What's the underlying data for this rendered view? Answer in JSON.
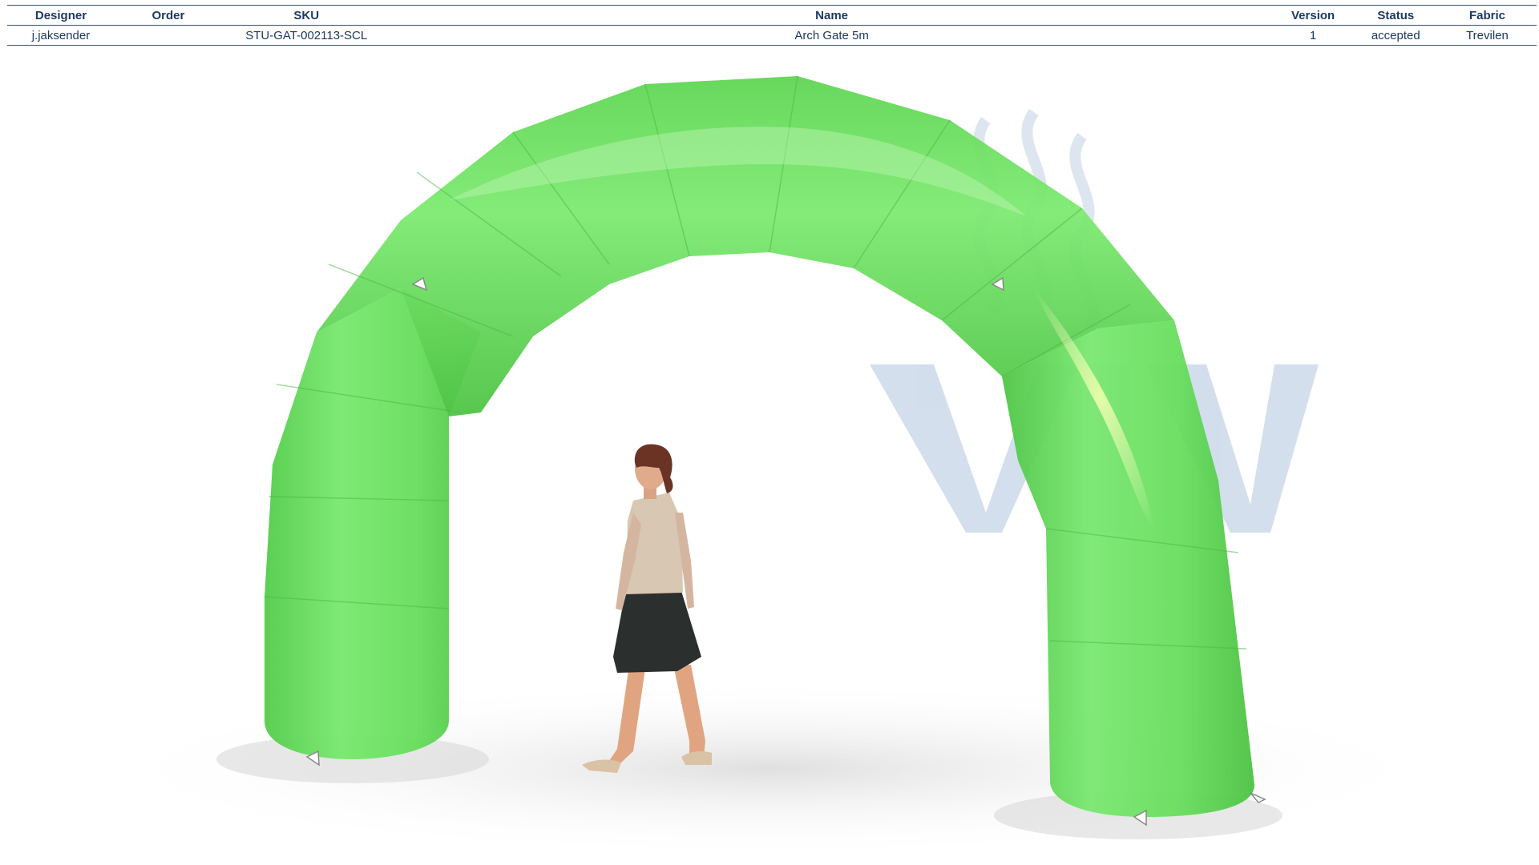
{
  "table": {
    "columns": [
      {
        "key": "designer",
        "label": "Designer"
      },
      {
        "key": "order",
        "label": "Order"
      },
      {
        "key": "sku",
        "label": "SKU"
      },
      {
        "key": "name",
        "label": "Name"
      },
      {
        "key": "version",
        "label": "Version"
      },
      {
        "key": "status",
        "label": "Status"
      },
      {
        "key": "fabric",
        "label": "Fabric"
      }
    ],
    "row": {
      "designer": "j.jaksender",
      "order": "",
      "sku": "STU-GAT-002113-SCL",
      "name": "Arch Gate 5m",
      "version": "1",
      "status": "accepted",
      "fabric": "Trevilen"
    }
  },
  "render": {
    "product_color": "#66e066",
    "watermark_color": "#9fb8d8",
    "watermark_icon": "viv-logo-watermark"
  }
}
